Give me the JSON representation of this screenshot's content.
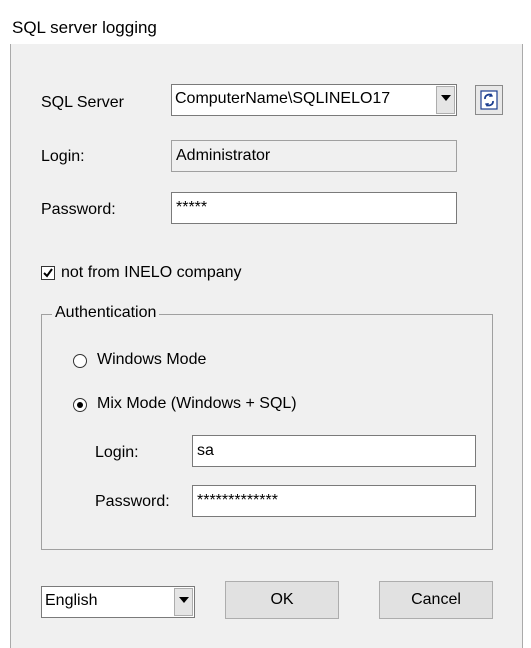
{
  "window": {
    "title": "SQL server logging"
  },
  "server": {
    "label": "SQL Server",
    "selected": "ComputerName\\SQLINELO17",
    "refresh_icon": "refresh-icon"
  },
  "login": {
    "label": "Login:",
    "value": "Administrator"
  },
  "password": {
    "label": "Password:",
    "value": "*****"
  },
  "not_inelo": {
    "label": "not from INELO company",
    "checked": true
  },
  "auth": {
    "legend": "Authentication",
    "windows_mode": "Windows Mode",
    "mix_mode": "Mix Mode (Windows + SQL)",
    "selected": "mix_mode",
    "login_label": "Login:",
    "login_value": "sa",
    "password_label": "Password:",
    "password_value": "*************"
  },
  "language": {
    "selected": "English"
  },
  "buttons": {
    "ok": "OK",
    "cancel": "Cancel"
  }
}
